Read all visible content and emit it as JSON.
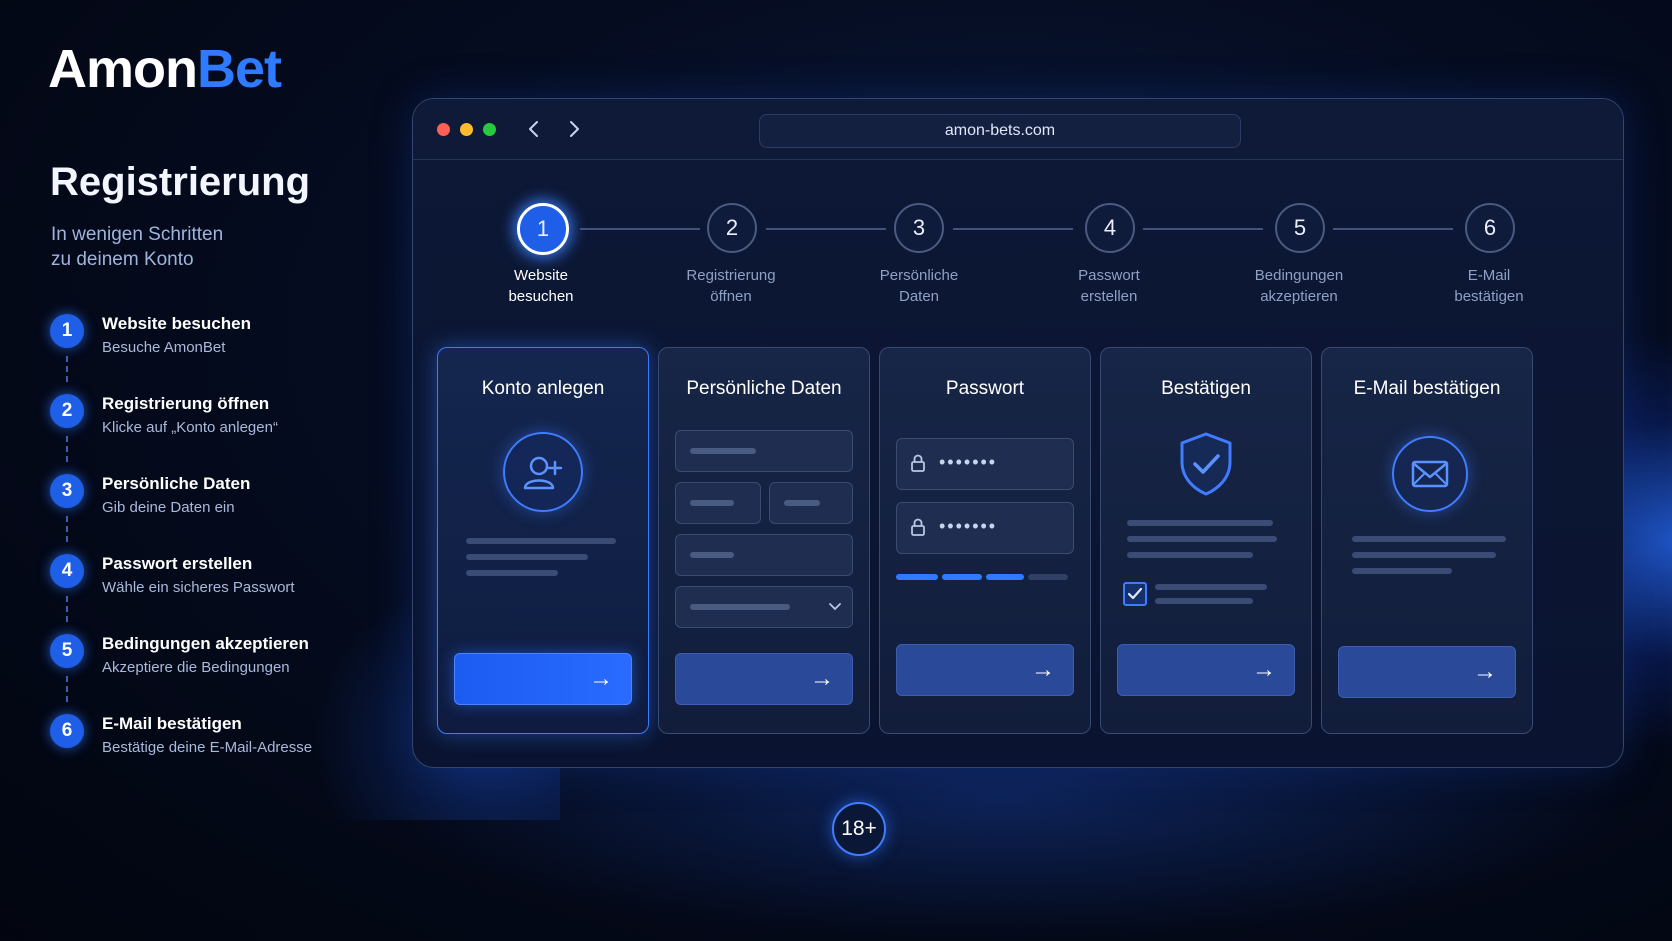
{
  "brand": {
    "name_part1": "Amon",
    "name_part2": "Bet"
  },
  "left": {
    "title": "Registrierung",
    "subtitle_line1": "In wenigen Schritten",
    "subtitle_line2": "zu deinem Konto",
    "steps": [
      {
        "num": "1",
        "title": "Website besuchen",
        "desc": "Besuche AmonBet"
      },
      {
        "num": "2",
        "title": "Registrierung öffnen",
        "desc": "Klicke auf „Konto anlegen“"
      },
      {
        "num": "3",
        "title": "Persönliche Daten",
        "desc": "Gib deine Daten ein"
      },
      {
        "num": "4",
        "title": "Passwort erstellen",
        "desc": "Wähle ein sicheres Passwort"
      },
      {
        "num": "5",
        "title": "Bedingungen akzeptieren",
        "desc": "Akzeptiere die Bedingungen"
      },
      {
        "num": "6",
        "title": "E-Mail bestätigen",
        "desc": "Bestätige deine E-Mail-Adresse"
      }
    ]
  },
  "browser": {
    "url": "amon-bets.com",
    "back_icon": "chevron-left-icon",
    "forward_icon": "chevron-right-icon",
    "progress": [
      {
        "num": "1",
        "line1": "Website",
        "line2": "besuchen",
        "active": true
      },
      {
        "num": "2",
        "line1": "Registrierung",
        "line2": "öffnen",
        "active": false
      },
      {
        "num": "3",
        "line1": "Persönliche",
        "line2": "Daten",
        "active": false
      },
      {
        "num": "4",
        "line1": "Passwort",
        "line2": "erstellen",
        "active": false
      },
      {
        "num": "5",
        "line1": "Bedingungen",
        "line2": "akzeptieren",
        "active": false
      },
      {
        "num": "6",
        "line1": "E-Mail",
        "line2": "bestätigen",
        "active": false
      }
    ],
    "cards": [
      {
        "title": "Konto anlegen",
        "icon": "user-plus-icon"
      },
      {
        "title": "Persönliche Daten",
        "icon": "chevron-down-icon"
      },
      {
        "title": "Passwort",
        "icon": "lock-icon",
        "password_mask": "•••••••",
        "strength": 0.75
      },
      {
        "title": "Bestätigen",
        "icon": "shield-check-icon"
      },
      {
        "title": "E-Mail bestätigen",
        "icon": "envelope-icon"
      }
    ],
    "button_arrow": "→"
  },
  "age_badge": "18+",
  "colors": {
    "accent": "#2f7bff",
    "background": "#050c20"
  }
}
